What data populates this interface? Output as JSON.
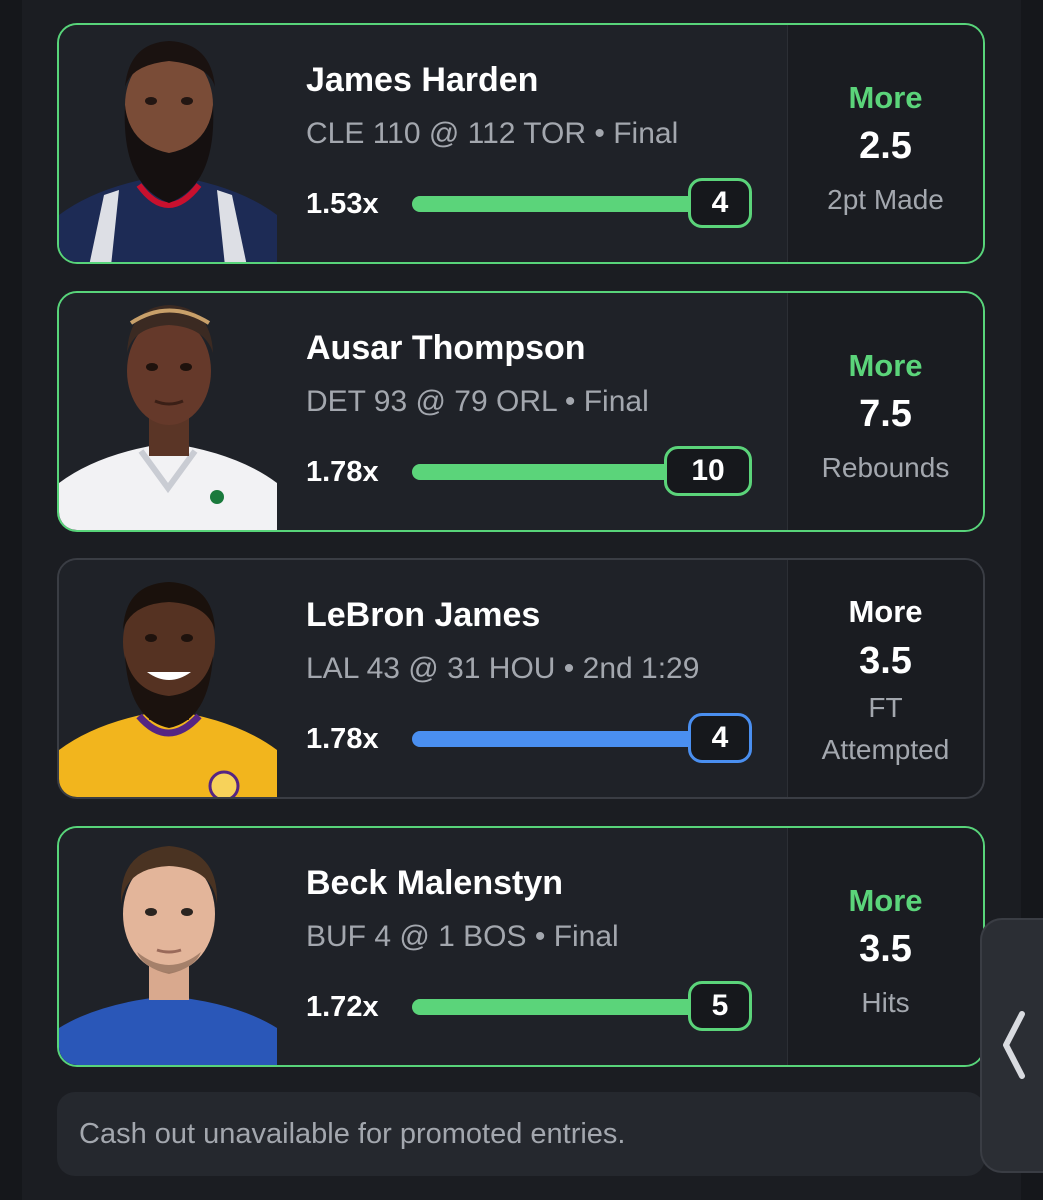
{
  "picks": [
    {
      "name": "James Harden",
      "game": "CLE 110 @ 112 TOR • Final",
      "multiplier": "1.53x",
      "current": "4",
      "progress": 1.0,
      "direction": "More",
      "line": "2.5",
      "stat": "2pt Made",
      "status": "won",
      "bar_color": "#5bd47a"
    },
    {
      "name": "Ausar Thompson",
      "game": "DET 93 @ 79 ORL • Final",
      "multiplier": "1.78x",
      "current": "10",
      "progress": 1.0,
      "direction": "More",
      "line": "7.5",
      "stat": "Rebounds",
      "status": "won",
      "bar_color": "#5bd47a"
    },
    {
      "name": "LeBron James",
      "game": "LAL 43 @ 31 HOU • 2nd 1:29",
      "multiplier": "1.78x",
      "current": "4",
      "progress": 1.0,
      "direction": "More",
      "line": "3.5",
      "stat_line1": "FT",
      "stat_line2": "Attempted",
      "status": "live",
      "bar_color": "#4a8ff0"
    },
    {
      "name": "Beck Malenstyn",
      "game": "BUF 4 @ 1 BOS • Final",
      "multiplier": "1.72x",
      "current": "5",
      "progress": 1.0,
      "direction": "More",
      "line": "3.5",
      "stat": "Hits",
      "status": "won",
      "bar_color": "#5bd47a"
    }
  ],
  "footer": {
    "message": "Cash out unavailable for promoted entries."
  },
  "side_handle": {
    "icon": "chevron-left-icon"
  },
  "colors": {
    "background": "#1b1d22",
    "card": "#1f2228",
    "won_border": "#58d47a",
    "accent_green": "#5bd47a",
    "accent_blue": "#4a8ff0",
    "muted_text": "#a3a7ae"
  }
}
